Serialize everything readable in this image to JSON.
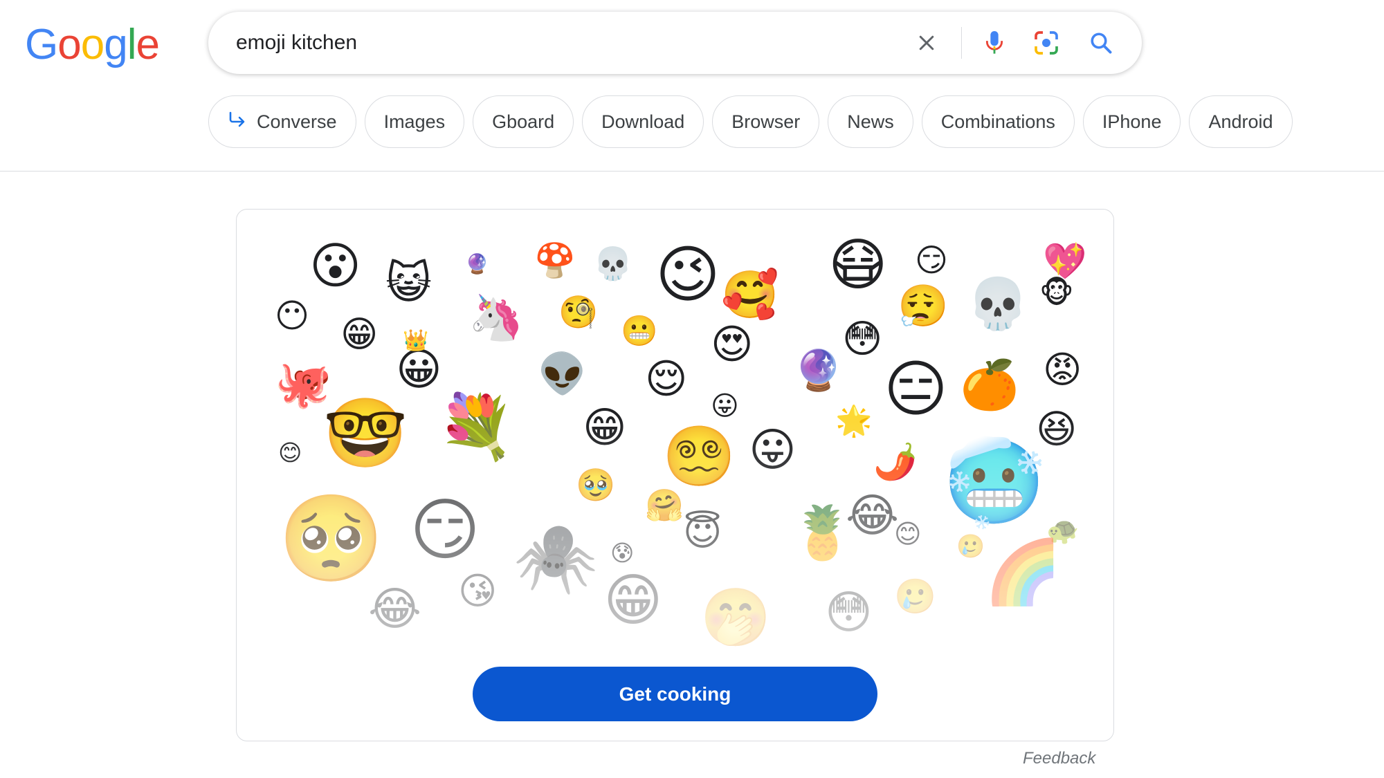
{
  "logo": {
    "letters": [
      "G",
      "o",
      "o",
      "g",
      "l",
      "e"
    ],
    "colors": [
      "#4285F4",
      "#EA4335",
      "#FBBC05",
      "#4285F4",
      "#34A853",
      "#EA4335"
    ]
  },
  "search": {
    "value": "emoji kitchen",
    "clear_icon": "close-icon",
    "voice_icon": "microphone-icon",
    "lens_icon": "camera-lens-icon",
    "search_icon": "search-icon"
  },
  "chips": [
    {
      "label": "Converse",
      "icon": "arrow-return-icon"
    },
    {
      "label": "Images"
    },
    {
      "label": "Gboard"
    },
    {
      "label": "Download"
    },
    {
      "label": "Browser"
    },
    {
      "label": "News"
    },
    {
      "label": "Combinations"
    },
    {
      "label": "IPhone"
    },
    {
      "label": "Android"
    }
  ],
  "kitchen": {
    "button_label": "Get cooking",
    "emojis": [
      "😮",
      "😺",
      "🔮",
      "🍄",
      "💀",
      "😉",
      "😶",
      "😁",
      "🦄",
      "🧐",
      "😬",
      "🥰",
      "😷",
      "😏",
      "😮‍💨",
      "💀",
      "🐵",
      "💖",
      "🐙",
      "😀",
      "👑",
      "👽",
      "😌",
      "😍",
      "🔮",
      "😳",
      "😑",
      "🍊",
      "😡",
      "😛",
      "🤓",
      "💐",
      "😁",
      "😵‍💫",
      "😛",
      "🌟",
      "🌶️",
      "😆",
      "😊",
      "🥹",
      "🥶",
      "🤗",
      "🥺",
      "😏",
      "🕷️",
      "😇",
      "🍍",
      "😂",
      "😊",
      "🐢",
      "😰",
      "🌈",
      "🥲",
      "😂",
      "😘",
      "😁",
      "🤭",
      "😳",
      "🥲"
    ],
    "colors": {
      "button": "#0b57d0"
    }
  },
  "feedback_label": "Feedback"
}
